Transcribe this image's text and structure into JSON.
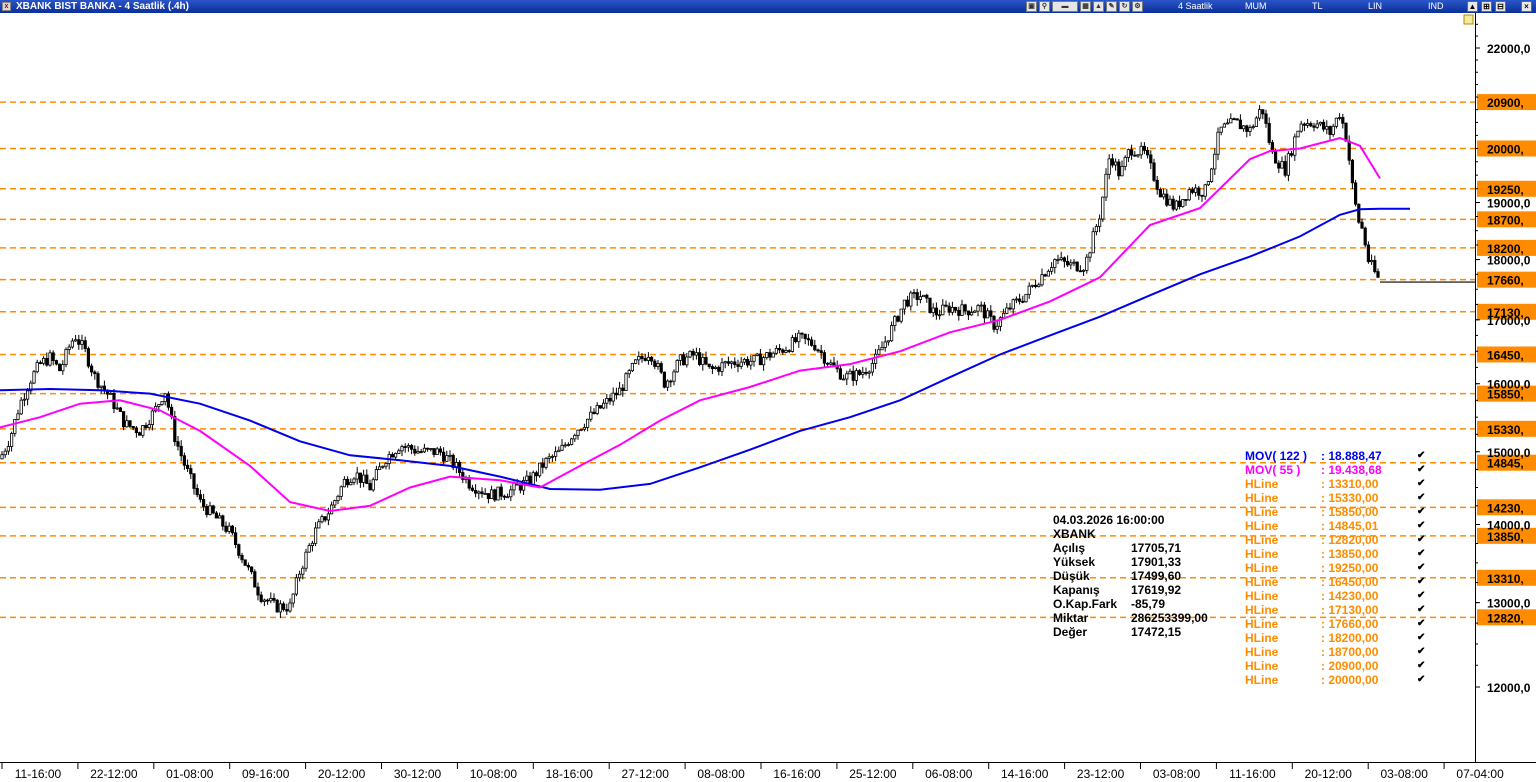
{
  "window": {
    "title": "XBANK BIST BANKA - 4 Saatlik (.4h)",
    "toolbar_items": [
      "4 Saatlik",
      "MUM",
      "TL",
      "LIN",
      "IND"
    ]
  },
  "info_panel": {
    "date": "04.03.2026  16:00:00",
    "symbol": "XBANK",
    "rows": [
      {
        "label": "Açılış",
        "value": "17705,71"
      },
      {
        "label": "Yüksek",
        "value": "17901,33"
      },
      {
        "label": "Düşük",
        "value": "17499,60"
      },
      {
        "label": "Kapanış",
        "value": "17619,92"
      },
      {
        "label": "O.Kap.Fark",
        "value": "-85,79"
      },
      {
        "label": "Miktar",
        "value": "286253399,00"
      },
      {
        "label": "Değer",
        "value": "17472,15"
      }
    ]
  },
  "legend": [
    {
      "name": "MOV( 122 )",
      "value": ": 18.888,47",
      "color": "#0000ee"
    },
    {
      "name": "MOV( 55 )",
      "value": ": 19.438,68",
      "color": "#ff00ff"
    },
    {
      "name": "HLine",
      "value": ": 13310,00",
      "color": "#ff8c00"
    },
    {
      "name": "HLine",
      "value": ": 15330,00",
      "color": "#ff8c00"
    },
    {
      "name": "HLine",
      "value": ": 15850,00",
      "color": "#ff8c00"
    },
    {
      "name": "HLine",
      "value": ": 14845,01",
      "color": "#ff8c00"
    },
    {
      "name": "HLine",
      "value": ": 12820,00",
      "color": "#ff8c00"
    },
    {
      "name": "HLine",
      "value": ": 13850,00",
      "color": "#ff8c00"
    },
    {
      "name": "HLine",
      "value": ": 19250,00",
      "color": "#ff8c00"
    },
    {
      "name": "HLine",
      "value": ": 16450,00",
      "color": "#ff8c00"
    },
    {
      "name": "HLine",
      "value": ": 14230,00",
      "color": "#ff8c00"
    },
    {
      "name": "HLine",
      "value": ": 17130,00",
      "color": "#ff8c00"
    },
    {
      "name": "HLine",
      "value": ": 17660,00",
      "color": "#ff8c00"
    },
    {
      "name": "HLine",
      "value": ": 18200,00",
      "color": "#ff8c00"
    },
    {
      "name": "HLine",
      "value": ": 18700,00",
      "color": "#ff8c00"
    },
    {
      "name": "HLine",
      "value": ": 20900,00",
      "color": "#ff8c00"
    },
    {
      "name": "HLine",
      "value": ": 20000,00",
      "color": "#ff8c00"
    }
  ],
  "chart_data": {
    "type": "candlestick",
    "y_scale": "log",
    "y_ticks": [
      "22000,0",
      "19000,0",
      "18000,0",
      "17000,0",
      "16000,0",
      "15000,0",
      "14000,0",
      "13000,0",
      "12000,0"
    ],
    "x_ticks": [
      "11-16:00",
      "22-12:00",
      "01-08:00",
      "09-16:00",
      "20-12:00",
      "30-12:00",
      "10-08:00",
      "18-16:00",
      "27-12:00",
      "08-08:00",
      "16-16:00",
      "25-12:00",
      "06-08:00",
      "14-16:00",
      "23-12:00",
      "03-08:00",
      "11-16:00",
      "20-12:00",
      "03-08:00",
      "07-04:00"
    ],
    "hlines": [
      {
        "value": 20900,
        "label": "20900,"
      },
      {
        "value": 20000,
        "label": "20000,"
      },
      {
        "value": 19250,
        "label": "19250,"
      },
      {
        "value": 18700,
        "label": "18700,"
      },
      {
        "value": 18200,
        "label": "18200,"
      },
      {
        "value": 17660,
        "label": "17660,"
      },
      {
        "value": 17130,
        "label": "17130,"
      },
      {
        "value": 16450,
        "label": "16450,"
      },
      {
        "value": 15850,
        "label": "15850,"
      },
      {
        "value": 15330,
        "label": "15330,"
      },
      {
        "value": 14845,
        "label": "14845,"
      },
      {
        "value": 14230,
        "label": "14230,"
      },
      {
        "value": 13850,
        "label": "13850,"
      },
      {
        "value": 13310,
        "label": "13310,"
      },
      {
        "value": 12820,
        "label": "12820,"
      }
    ],
    "last_close": 17619.92,
    "close_path": [
      [
        0,
        14900
      ],
      [
        10,
        15200
      ],
      [
        20,
        15700
      ],
      [
        30,
        16050
      ],
      [
        40,
        16300
      ],
      [
        50,
        16400
      ],
      [
        60,
        16200
      ],
      [
        70,
        16600
      ],
      [
        75,
        16750
      ],
      [
        85,
        16500
      ],
      [
        95,
        16100
      ],
      [
        110,
        15800
      ],
      [
        125,
        15400
      ],
      [
        140,
        15300
      ],
      [
        155,
        15600
      ],
      [
        165,
        15900
      ],
      [
        175,
        15200
      ],
      [
        185,
        14800
      ],
      [
        200,
        14300
      ],
      [
        215,
        14100
      ],
      [
        230,
        13900
      ],
      [
        245,
        13500
      ],
      [
        260,
        13100
      ],
      [
        275,
        12950
      ],
      [
        290,
        12950
      ],
      [
        300,
        13400
      ],
      [
        315,
        13900
      ],
      [
        330,
        14200
      ],
      [
        345,
        14600
      ],
      [
        355,
        14700
      ],
      [
        370,
        14500
      ],
      [
        385,
        14900
      ],
      [
        400,
        15100
      ],
      [
        420,
        15000
      ],
      [
        440,
        15000
      ],
      [
        455,
        14800
      ],
      [
        470,
        14550
      ],
      [
        490,
        14400
      ],
      [
        510,
        14450
      ],
      [
        530,
        14600
      ],
      [
        545,
        14850
      ],
      [
        560,
        15000
      ],
      [
        575,
        15300
      ],
      [
        590,
        15500
      ],
      [
        605,
        15700
      ],
      [
        620,
        15900
      ],
      [
        635,
        16300
      ],
      [
        650,
        16500
      ],
      [
        665,
        16000
      ],
      [
        680,
        16350
      ],
      [
        695,
        16450
      ],
      [
        710,
        16200
      ],
      [
        725,
        16300
      ],
      [
        740,
        16350
      ],
      [
        755,
        16350
      ],
      [
        770,
        16450
      ],
      [
        785,
        16550
      ],
      [
        800,
        16700
      ],
      [
        815,
        16600
      ],
      [
        830,
        16300
      ],
      [
        845,
        16100
      ],
      [
        860,
        16150
      ],
      [
        875,
        16350
      ],
      [
        890,
        16800
      ],
      [
        905,
        17300
      ],
      [
        920,
        17400
      ],
      [
        935,
        17100
      ],
      [
        950,
        17200
      ],
      [
        965,
        17150
      ],
      [
        980,
        17200
      ],
      [
        995,
        16900
      ],
      [
        1010,
        17200
      ],
      [
        1025,
        17400
      ],
      [
        1040,
        17700
      ],
      [
        1055,
        18000
      ],
      [
        1070,
        17900
      ],
      [
        1085,
        17900
      ],
      [
        1100,
        18800
      ],
      [
        1110,
        19900
      ],
      [
        1120,
        19500
      ],
      [
        1130,
        20000
      ],
      [
        1145,
        19900
      ],
      [
        1160,
        19200
      ],
      [
        1175,
        18900
      ],
      [
        1190,
        19250
      ],
      [
        1205,
        19200
      ],
      [
        1220,
        20350
      ],
      [
        1235,
        20500
      ],
      [
        1250,
        20350
      ],
      [
        1262,
        20800
      ],
      [
        1272,
        19900
      ],
      [
        1285,
        19600
      ],
      [
        1300,
        20500
      ],
      [
        1315,
        20500
      ],
      [
        1330,
        20300
      ],
      [
        1340,
        20700
      ],
      [
        1347,
        20150
      ],
      [
        1353,
        19200
      ],
      [
        1358,
        18700
      ],
      [
        1363,
        18500
      ],
      [
        1368,
        18000
      ],
      [
        1374,
        17800
      ],
      [
        1380,
        17620
      ]
    ],
    "mov122_path": [
      [
        0,
        15900
      ],
      [
        50,
        15920
      ],
      [
        100,
        15900
      ],
      [
        150,
        15850
      ],
      [
        200,
        15700
      ],
      [
        250,
        15450
      ],
      [
        300,
        15150
      ],
      [
        350,
        14950
      ],
      [
        400,
        14880
      ],
      [
        450,
        14800
      ],
      [
        500,
        14650
      ],
      [
        550,
        14480
      ],
      [
        600,
        14470
      ],
      [
        650,
        14550
      ],
      [
        700,
        14780
      ],
      [
        750,
        15030
      ],
      [
        800,
        15300
      ],
      [
        850,
        15500
      ],
      [
        900,
        15750
      ],
      [
        950,
        16100
      ],
      [
        1000,
        16450
      ],
      [
        1050,
        16750
      ],
      [
        1100,
        17050
      ],
      [
        1150,
        17400
      ],
      [
        1200,
        17750
      ],
      [
        1250,
        18050
      ],
      [
        1300,
        18400
      ],
      [
        1340,
        18780
      ],
      [
        1360,
        18880
      ],
      [
        1380,
        18888
      ]
    ],
    "mov55_path": [
      [
        0,
        15350
      ],
      [
        40,
        15500
      ],
      [
        80,
        15700
      ],
      [
        120,
        15750
      ],
      [
        160,
        15600
      ],
      [
        200,
        15300
      ],
      [
        250,
        14800
      ],
      [
        290,
        14300
      ],
      [
        330,
        14180
      ],
      [
        370,
        14250
      ],
      [
        410,
        14500
      ],
      [
        450,
        14650
      ],
      [
        500,
        14600
      ],
      [
        540,
        14500
      ],
      [
        580,
        14800
      ],
      [
        620,
        15100
      ],
      [
        660,
        15450
      ],
      [
        700,
        15750
      ],
      [
        750,
        15950
      ],
      [
        800,
        16200
      ],
      [
        850,
        16300
      ],
      [
        900,
        16500
      ],
      [
        950,
        16800
      ],
      [
        1000,
        17000
      ],
      [
        1050,
        17300
      ],
      [
        1100,
        17700
      ],
      [
        1150,
        18600
      ],
      [
        1200,
        18900
      ],
      [
        1250,
        19800
      ],
      [
        1270,
        19950
      ],
      [
        1300,
        20000
      ],
      [
        1340,
        20200
      ],
      [
        1360,
        20050
      ],
      [
        1380,
        19438
      ]
    ]
  }
}
